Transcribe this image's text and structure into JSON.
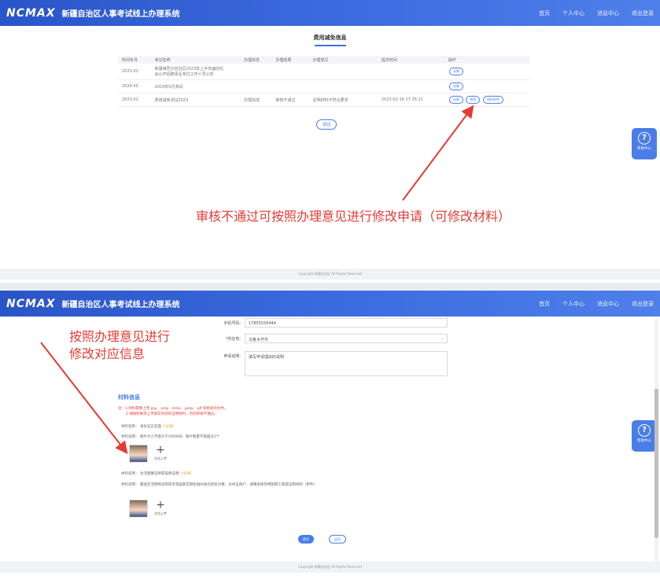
{
  "header": {
    "logo": "NCMAX",
    "title": "新疆自治区人事考试线上办理系统",
    "nav": [
      "首页",
      "个人中心",
      "消息中心",
      "退出登录"
    ]
  },
  "top_page": {
    "title": "费用减免信息",
    "table": {
      "columns": [
        "时间年月",
        "考试名称",
        "",
        "办理状态",
        "办理结果",
        "办理意见",
        "",
        "提交时间",
        "操作"
      ],
      "rows": [
        {
          "date": "2023-02",
          "exam": "新疆维吾尔自治区2023年上半年面向社会公开招聘事业单位工作人员公告",
          "status": "",
          "result": "",
          "opinion": "",
          "time": "",
          "actions": [
            "详情"
          ]
        },
        {
          "date": "2024-05",
          "exam": "2024年5月测试",
          "status": "",
          "result": "",
          "opinion": "",
          "time": "",
          "actions": [
            "详情"
          ]
        },
        {
          "date": "2023-02",
          "exam": "费用减免测试2023",
          "status": "办理完成",
          "result": "审核不通过",
          "opinion": "证明材料不符合要求",
          "time": "2023-02-16 17:35:21",
          "actions": [
            "详情",
            "修改",
            "材料补传"
          ]
        }
      ]
    },
    "back_button": "返回",
    "annotation": "审核不通过可按照办理意见进行修改申请（可修改材料）",
    "footer": "Copyright 新疆自治区 All Rights Reserved"
  },
  "help": {
    "label": "帮助中心",
    "icon": "?"
  },
  "bottom_page": {
    "annotation_line1": "按照办理意见进行",
    "annotation_line2": "修改对应信息",
    "form": {
      "phone_label": "手机号码:",
      "phone_value": "17855556444",
      "region_label": "*所在地:",
      "region_value": "乌鲁木齐市",
      "reason_label": "申请说明:",
      "reason_value": "填写申请理由的说明"
    },
    "materials": {
      "title": "材料信息",
      "note1": "注：1.材料需要上传.jpg、.png、.bmp、.jpeg、.gif 等格式的文件。",
      "note2": "2.请按照要求上传真实有效的证明材料，否则审核不通过。",
      "item1_name_label": "材料名称：",
      "item1_name": "身份证正反面",
      "item1_required": "(*必填)",
      "item1_desc_label": "材料说明：",
      "item1_desc": "图片大小不能大于5000KB，图片数量不能超过3个",
      "item2_name_label": "材料名称：",
      "item2_name": "生活困难证明或低保证明",
      "item2_required": "(*必填)",
      "item2_desc_label": "材料说明：",
      "item2_desc": "最低生活保障证明或享受国家定期抚恤补助的优抚对象、农村五保户、城镇低保及特困职工家庭证明材料（原件）",
      "upload_label": "点击上传"
    },
    "submit_button": "提交",
    "return_button": "返回",
    "footer": "Copyright 新疆自治区 All Rights Reserved"
  },
  "colors": {
    "header": "#3e6fe2",
    "accent": "#4a7ee6",
    "annotation": "#e53b35"
  }
}
